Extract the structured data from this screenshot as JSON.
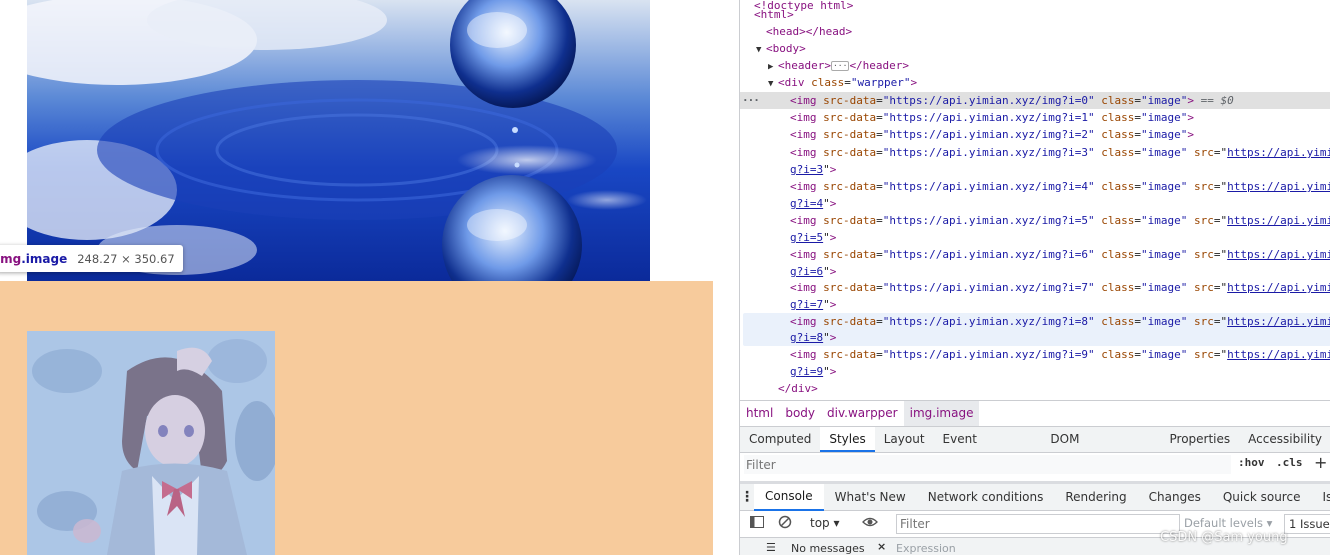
{
  "tooltip": {
    "tag": "img",
    "class": ".image",
    "dims": "248.27 × 350.67"
  },
  "elements_tree": {
    "html_open": "<html>",
    "head": "<head></head>",
    "body_open": "<body>",
    "header": "<header>",
    "header_close": "</header>",
    "div_open_tag": "<div",
    "div_attr_name": "class",
    "div_attr_value": "\"warpper\"",
    "div_open_end": ">",
    "div_close": "</div>",
    "selected_suffix": "== $0",
    "img_rows": [
      {
        "srcdata": "\"https://api.yimian.xyz/img?i=0\"",
        "src": "",
        "cont": ""
      },
      {
        "srcdata": "\"https://api.yimian.xyz/img?i=1\"",
        "src": "",
        "cont": ""
      },
      {
        "srcdata": "\"https://api.yimian.xyz/img?i=2\"",
        "src": "",
        "cont": ""
      },
      {
        "srcdata": "\"https://api.yimian.xyz/img?i=3\"",
        "src": "https://api.yimi",
        "cont": "g?i=3"
      },
      {
        "srcdata": "\"https://api.yimian.xyz/img?i=4\"",
        "src": "https://api.yimi",
        "cont": "g?i=4"
      },
      {
        "srcdata": "\"https://api.yimian.xyz/img?i=5\"",
        "src": "https://api.yimi",
        "cont": "g?i=5"
      },
      {
        "srcdata": "\"https://api.yimian.xyz/img?i=6\"",
        "src": "https://api.yimi",
        "cont": "g?i=6"
      },
      {
        "srcdata": "\"https://api.yimian.xyz/img?i=7\"",
        "src": "https://api.yimi",
        "cont": "g?i=7"
      },
      {
        "srcdata": "\"https://api.yimian.xyz/img?i=8\"",
        "src": "https://api.yimi",
        "cont": "g?i=8"
      },
      {
        "srcdata": "\"https://api.yimian.xyz/img?i=9\"",
        "src": "https://api.yimi",
        "cont": "g?i=9"
      }
    ],
    "img_tag": "<img",
    "attr_srcdata": "src-data",
    "attr_class": "class",
    "attr_class_value": "\"image\"",
    "attr_src": "src",
    "close_gt": ">"
  },
  "breadcrumb": [
    "html",
    "body",
    "div.warpper",
    "img.image"
  ],
  "styles_tabs": [
    "Computed",
    "Styles",
    "Layout",
    "Event Listeners",
    "DOM Breakpoints",
    "Properties",
    "Accessibility"
  ],
  "styles_active_tab": "Styles",
  "styles_filter": {
    "placeholder": "Filter",
    "hov": ":hov",
    "cls": ".cls",
    "plus": "+"
  },
  "drawer_tabs": [
    "Console",
    "What's New",
    "Network conditions",
    "Rendering",
    "Changes",
    "Quick source",
    "Iss"
  ],
  "drawer_active_tab": "Console",
  "console_toolbar": {
    "context": "top",
    "filter_placeholder": "Filter",
    "levels": "Default levels ▾",
    "issues": "1 Issue:"
  },
  "console_bottom": {
    "messages": "No messages",
    "expression": "Expression"
  },
  "watermark": "CSDN @Sam young",
  "colors": {
    "margin_overlay": "#f7cb9c",
    "tag": "#881280",
    "attr_name": "#994500",
    "attr_value": "#1a1aa6",
    "active_tab": "#1a73e8"
  }
}
